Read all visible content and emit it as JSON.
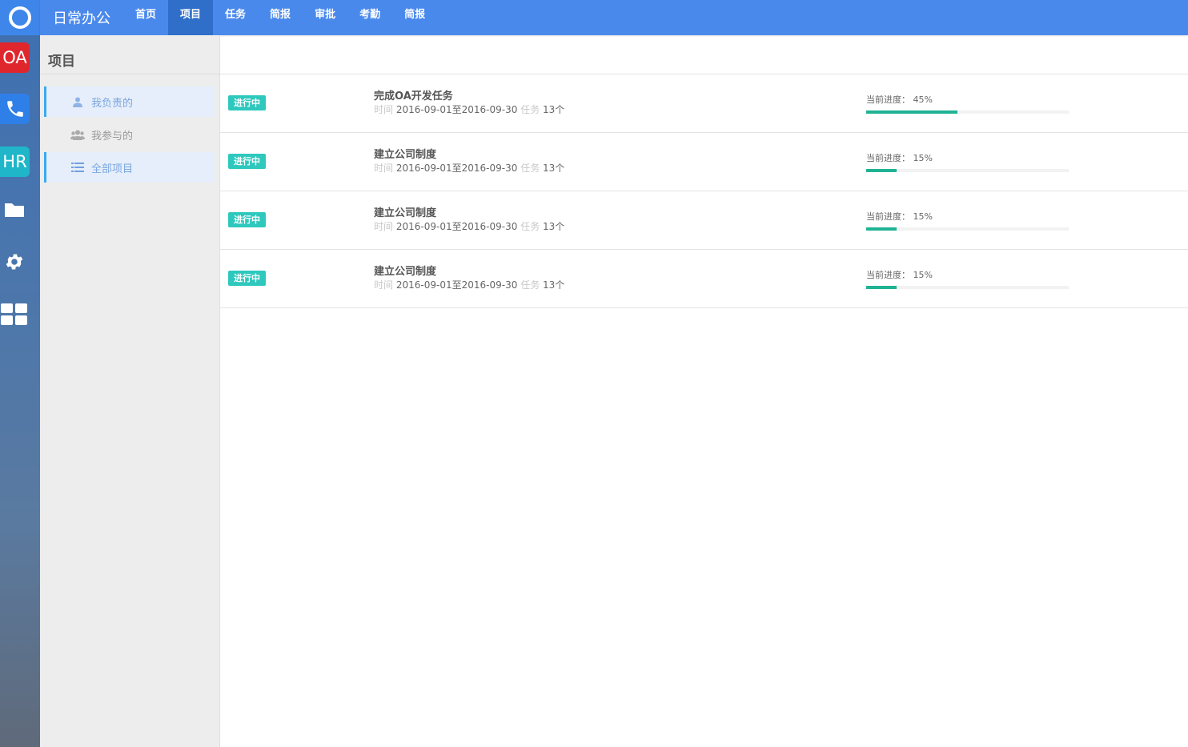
{
  "app": {
    "brand": "日常办公"
  },
  "dock": {
    "items": [
      {
        "name": "home-ring-icon"
      },
      {
        "name": "oa-app-tile",
        "label": "OA",
        "color": "#e0262d"
      },
      {
        "name": "phone-icon",
        "color": "#2f7fe8"
      },
      {
        "name": "hr-app-tile",
        "label": "HR",
        "color": "#1fb6c9"
      },
      {
        "name": "folder-icon"
      },
      {
        "name": "gear-icon"
      },
      {
        "name": "grid-apps-icon"
      }
    ]
  },
  "nav": {
    "items": [
      "首页",
      "项目",
      "任务",
      "简报",
      "审批",
      "考勤",
      "简报"
    ],
    "active": "项目"
  },
  "sidebar": {
    "title": "项目",
    "items": [
      {
        "label": "我负责的",
        "icon": "user-icon",
        "selected": true
      },
      {
        "label": "我参与的",
        "icon": "users-icon",
        "selected": false
      },
      {
        "label": "全部项目",
        "icon": "list-icon",
        "selected": true
      }
    ]
  },
  "projects": [
    {
      "status": "进行中",
      "title": "完成OA开发任务",
      "time_label": "时间",
      "start": "2016-09-01",
      "sep": "至",
      "end": "2016-09-30",
      "task_label": "任务",
      "task_count": "13个",
      "progress_label": "当前进度：",
      "progress_text": "45%",
      "progress": 45
    },
    {
      "status": "进行中",
      "title": "建立公司制度",
      "time_label": "时间",
      "start": "2016-09-01",
      "sep": "至",
      "end": "2016-09-30",
      "task_label": "任务",
      "task_count": "13个",
      "progress_label": "当前进度：",
      "progress_text": "15%",
      "progress": 15
    },
    {
      "status": "进行中",
      "title": "建立公司制度",
      "time_label": "时间",
      "start": "2016-09-01",
      "sep": "至",
      "end": "2016-09-30",
      "task_label": "任务",
      "task_count": "13个",
      "progress_label": "当前进度：",
      "progress_text": "15%",
      "progress": 15
    },
    {
      "status": "进行中",
      "title": "建立公司制度",
      "time_label": "时间",
      "start": "2016-09-01",
      "sep": "至",
      "end": "2016-09-30",
      "task_label": "任务",
      "task_count": "13个",
      "progress_label": "当前进度：",
      "progress_text": "15%",
      "progress": 15
    }
  ],
  "colors": {
    "topbar": "#4a89ec",
    "nav_active": "#2f6fc9",
    "badge": "#2ec8bd",
    "progress": "#1fb394"
  }
}
